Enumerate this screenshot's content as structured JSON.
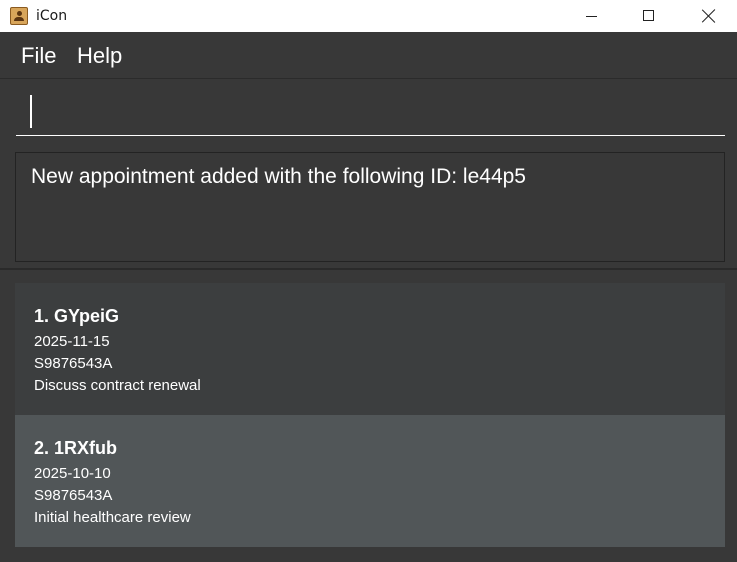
{
  "window": {
    "title": "iCon",
    "icon": "contact-book-icon"
  },
  "menu": {
    "file": "File",
    "help": "Help"
  },
  "command": {
    "value": "",
    "placeholder": ""
  },
  "result": {
    "message": "New appointment added with the following ID: le44p5"
  },
  "appointments": [
    {
      "title": "1. GYpeiG",
      "date": "2025-11-15",
      "nric": "S9876543A",
      "description": "Discuss contract renewal"
    },
    {
      "title": "2. 1RXfub",
      "date": "2025-10-10",
      "nric": "S9876543A",
      "description": "Initial healthcare review"
    }
  ],
  "colors": {
    "background": "#383838",
    "card_odd": "#3c3e3f",
    "card_selected": "#515658",
    "text": "#ffffff"
  }
}
